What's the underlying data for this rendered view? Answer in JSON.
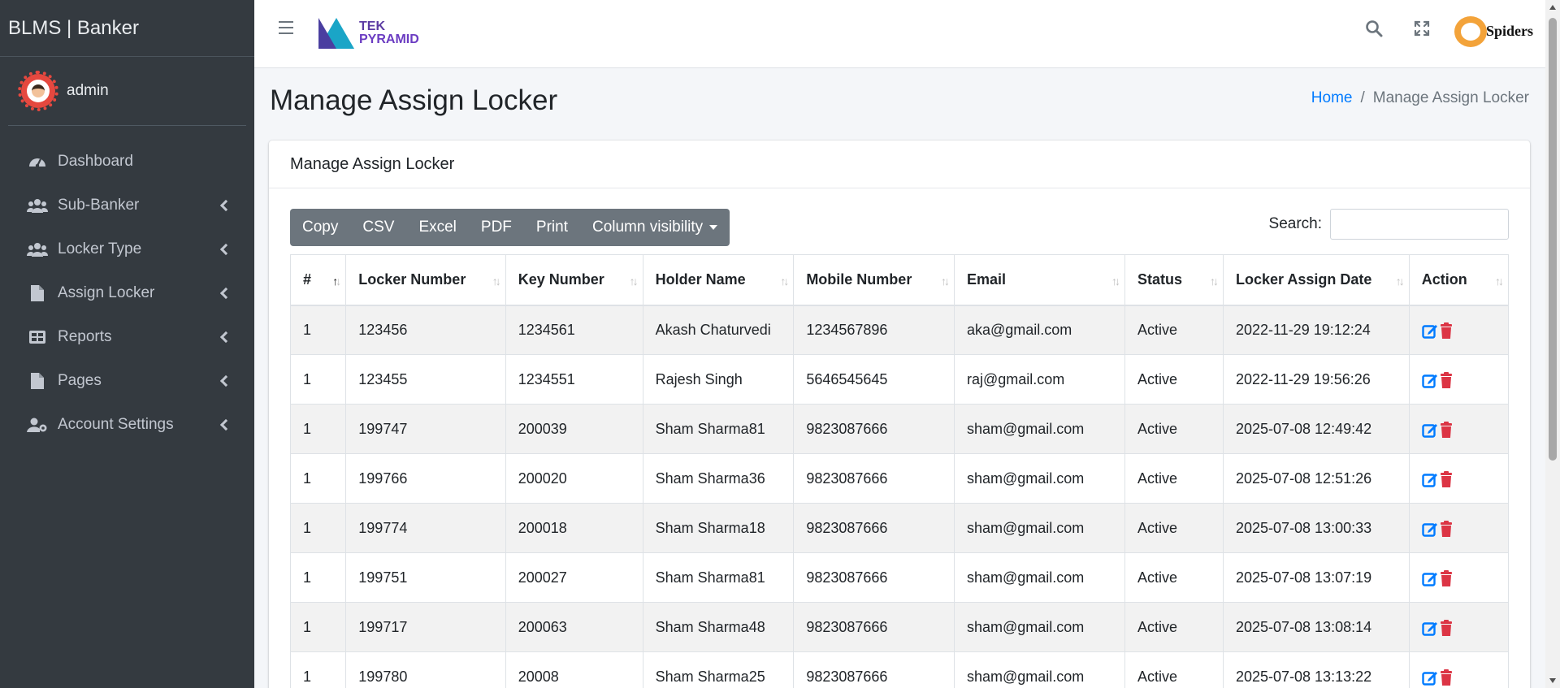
{
  "app": {
    "brand": "BLMS | Banker",
    "user": "admin"
  },
  "sidebar": {
    "items": [
      {
        "label": "Dashboard",
        "icon": "dashboard-icon",
        "has_children": false
      },
      {
        "label": "Sub-Banker",
        "icon": "users-icon",
        "has_children": true
      },
      {
        "label": "Locker Type",
        "icon": "users-icon",
        "has_children": true
      },
      {
        "label": "Assign Locker",
        "icon": "file-icon",
        "has_children": true
      },
      {
        "label": "Reports",
        "icon": "table-icon",
        "has_children": true
      },
      {
        "label": "Pages",
        "icon": "file-icon",
        "has_children": true
      },
      {
        "label": "Account Settings",
        "icon": "user-cog-icon",
        "has_children": true
      }
    ]
  },
  "header": {
    "logo_line1": "TEK",
    "logo_line2": "PYRAMID",
    "partner_logo_text": "Spiders"
  },
  "page": {
    "title": "Manage Assign Locker",
    "breadcrumb": {
      "home": "Home",
      "separator": "/",
      "current": "Manage Assign Locker"
    }
  },
  "card": {
    "title": "Manage Assign Locker",
    "buttons": {
      "copy": "Copy",
      "csv": "CSV",
      "excel": "Excel",
      "pdf": "PDF",
      "print": "Print",
      "colvis": "Column visibility"
    },
    "search_label": "Search:",
    "search_value": ""
  },
  "table": {
    "columns": [
      "#",
      "Locker Number",
      "Key Number",
      "Holder Name",
      "Mobile Number",
      "Email",
      "Status",
      "Locker Assign Date",
      "Action"
    ],
    "sorted_column": "#",
    "rows": [
      [
        "1",
        "123456",
        "1234561",
        "Akash Chaturvedi",
        "1234567896",
        "aka@gmail.com",
        "Active",
        "2022-11-29 19:12:24"
      ],
      [
        "1",
        "123455",
        "1234551",
        "Rajesh Singh",
        "5646545645",
        "raj@gmail.com",
        "Active",
        "2022-11-29 19:56:26"
      ],
      [
        "1",
        "199747",
        "200039",
        "Sham Sharma81",
        "9823087666",
        "sham@gmail.com",
        "Active",
        "2025-07-08 12:49:42"
      ],
      [
        "1",
        "199766",
        "200020",
        "Sham Sharma36",
        "9823087666",
        "sham@gmail.com",
        "Active",
        "2025-07-08 12:51:26"
      ],
      [
        "1",
        "199774",
        "200018",
        "Sham Sharma18",
        "9823087666",
        "sham@gmail.com",
        "Active",
        "2025-07-08 13:00:33"
      ],
      [
        "1",
        "199751",
        "200027",
        "Sham Sharma81",
        "9823087666",
        "sham@gmail.com",
        "Active",
        "2025-07-08 13:07:19"
      ],
      [
        "1",
        "199717",
        "200063",
        "Sham Sharma48",
        "9823087666",
        "sham@gmail.com",
        "Active",
        "2025-07-08 13:08:14"
      ],
      [
        "1",
        "199780",
        "20008",
        "Sham Sharma25",
        "9823087666",
        "sham@gmail.com",
        "Active",
        "2025-07-08 13:13:22"
      ]
    ]
  },
  "colors": {
    "sidebar_bg": "#343a40",
    "link": "#007bff",
    "edit_icon": "#007bff",
    "delete_icon": "#dc3545",
    "button_bg": "#6c757d"
  }
}
